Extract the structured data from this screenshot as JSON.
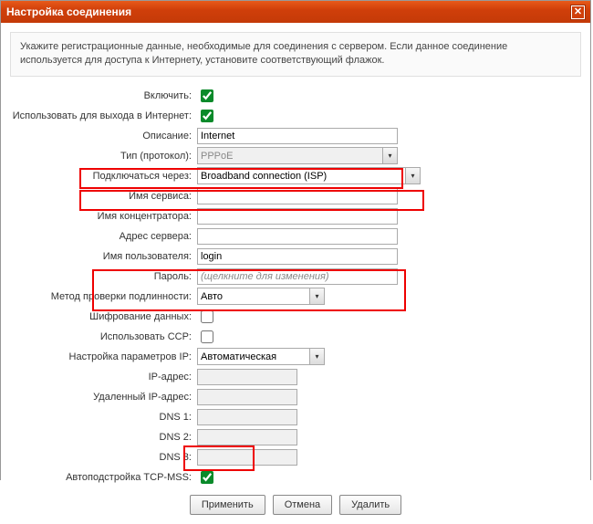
{
  "window": {
    "title": "Настройка соединения"
  },
  "info": {
    "text": "Укажите регистрационные данные, необходимые для соединения с сервером. Если данное соединение используется для доступа к Интернету, установите соответствующий флажок."
  },
  "labels": {
    "enable": "Включить:",
    "use_internet": "Использовать для выхода в Интернет:",
    "description": "Описание:",
    "protocol": "Тип (протокол):",
    "connect_via": "Подключаться через:",
    "service_name": "Имя сервиса:",
    "concentrator": "Имя концентратора:",
    "server_addr": "Адрес сервера:",
    "username": "Имя пользователя:",
    "password": "Пароль:",
    "auth_method": "Метод проверки подлинности:",
    "encryption": "Шифрование данных:",
    "use_ccp": "Использовать CCP:",
    "ip_settings": "Настройка параметров IP:",
    "ip_addr": "IP-адрес:",
    "remote_ip": "Удаленный IP-адрес:",
    "dns1": "DNS 1:",
    "dns2": "DNS 2:",
    "dns3": "DNS 3:",
    "tcp_mss": "Автоподстройка TCP-MSS:"
  },
  "values": {
    "enable": true,
    "use_internet": true,
    "description": "Internet",
    "protocol": "PPPoE",
    "connect_via": "Broadband connection (ISP)",
    "service_name": "",
    "concentrator": "",
    "server_addr": "",
    "username": "login",
    "password_placeholder": "(щелкните для изменения)",
    "auth_method": "Авто",
    "encryption": false,
    "use_ccp": false,
    "ip_settings": "Автоматическая",
    "ip_addr": "",
    "remote_ip": "",
    "dns1": "",
    "dns2": "",
    "dns3": "",
    "tcp_mss": true
  },
  "buttons": {
    "apply": "Применить",
    "cancel": "Отмена",
    "delete": "Удалить"
  }
}
